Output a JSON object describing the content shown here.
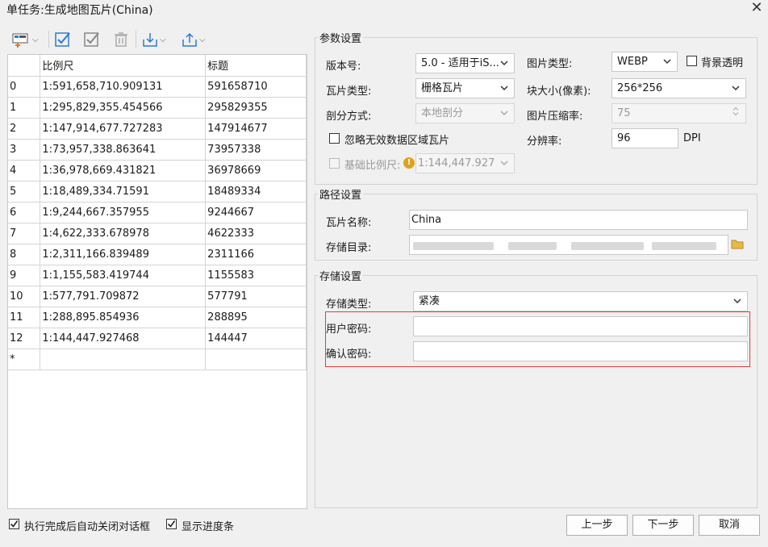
{
  "window": {
    "title": "单任务:生成地图瓦片(China)"
  },
  "toolbar": {
    "icons": [
      "add-scale-icon",
      "check-all-icon",
      "check-selected-icon",
      "delete-icon",
      "import-icon",
      "export-icon"
    ]
  },
  "table": {
    "headers": [
      "",
      "比例尺",
      "标题"
    ],
    "rows": [
      [
        "0",
        "1:591,658,710.909131",
        "591658710"
      ],
      [
        "1",
        "1:295,829,355.454566",
        "295829355"
      ],
      [
        "2",
        "1:147,914,677.727283",
        "147914677"
      ],
      [
        "3",
        "1:73,957,338.863641",
        "73957338"
      ],
      [
        "4",
        "1:36,978,669.431821",
        "36978669"
      ],
      [
        "5",
        "1:18,489,334.71591",
        "18489334"
      ],
      [
        "6",
        "1:9,244,667.357955",
        "9244667"
      ],
      [
        "7",
        "1:4,622,333.678978",
        "4622333"
      ],
      [
        "8",
        "1:2,311,166.839489",
        "2311166"
      ],
      [
        "9",
        "1:1,155,583.419744",
        "1155583"
      ],
      [
        "10",
        "1:577,791.709872",
        "577791"
      ],
      [
        "11",
        "1:288,895.854936",
        "288895"
      ],
      [
        "12",
        "1:144,447.927468",
        "144447"
      ]
    ],
    "new_row_marker": "*"
  },
  "params": {
    "title": "参数设置",
    "version_label": "版本号:",
    "version_value": "5.0 - 适用于iS...",
    "image_type_label": "图片类型:",
    "image_type_value": "WEBP",
    "transparent_label": "背景透明",
    "tile_type_label": "瓦片类型:",
    "tile_type_value": "栅格瓦片",
    "block_size_label": "块大小(像素):",
    "block_size_value": "256*256",
    "split_label": "剖分方式:",
    "split_value": "本地剖分",
    "compress_label": "图片压缩率:",
    "compress_value": "75",
    "ignore_label": "忽略无效数据区域瓦片",
    "dpi_label": "分辨率:",
    "dpi_value": "96",
    "dpi_unit": "DPI",
    "base_scale_label": "基础比例尺:",
    "base_scale_value": "1:144,447.927"
  },
  "path": {
    "title": "路径设置",
    "name_label": "瓦片名称:",
    "name_value": "China",
    "dir_label": "存储目录:"
  },
  "storage": {
    "title": "存储设置",
    "type_label": "存储类型:",
    "type_value": "紧凑",
    "user_pw_label": "用户密码:",
    "confirm_pw_label": "确认密码:"
  },
  "footer": {
    "auto_close_label": "执行完成后自动关闭对话框",
    "progress_label": "显示进度条",
    "prev_label": "上一步",
    "next_label": "下一步",
    "cancel_label": "取消"
  },
  "colors": {
    "accent": "#2a7ad5",
    "highlight_border": "#e03c3c",
    "folder": "#e8b84a"
  }
}
